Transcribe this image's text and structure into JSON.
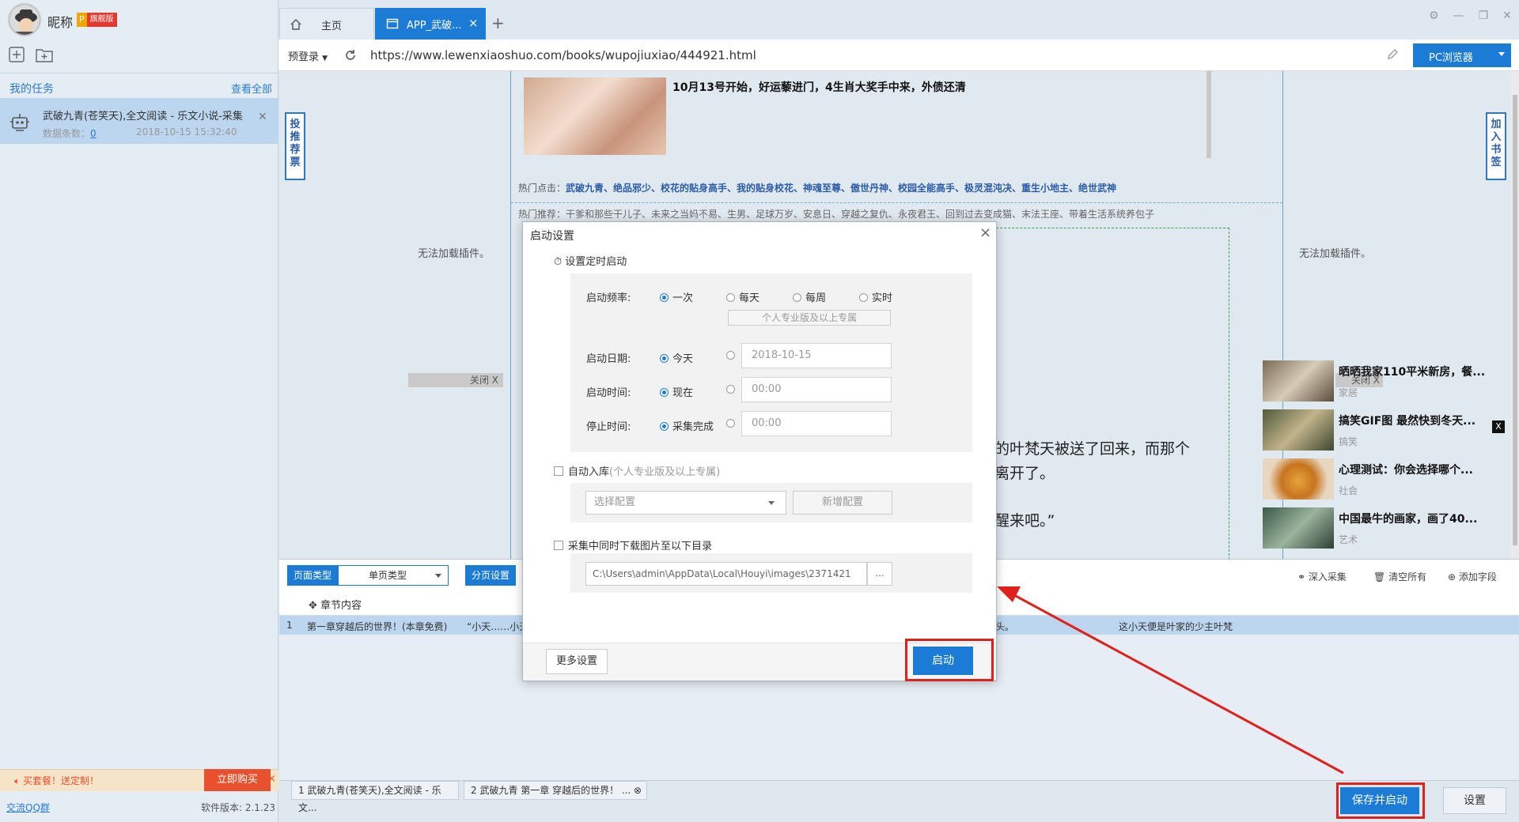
{
  "user": {
    "nickname": "昵称",
    "vip_p": "P",
    "vip_label": "旗舰版"
  },
  "tasks": {
    "title": "我的任务",
    "view_all": "查看全部",
    "items": [
      {
        "title": "武破九青(苍笑天),全文阅读 - 乐文小说-采集",
        "count_label": "数据条数：",
        "count": "0",
        "time": "2018-10-15 15:32:40"
      }
    ]
  },
  "promo": {
    "text": "买套餐！送定制！",
    "buy": "立即购买",
    "close": "×"
  },
  "footer": {
    "qq": "交流QQ群",
    "version": "软件版本: 2.1.23"
  },
  "tabs": {
    "home": "主页",
    "app": "APP_武破...",
    "close": "×",
    "plus": "+"
  },
  "addressbar": {
    "prelogin": "预登录",
    "url": "https://www.lewenxiaoshuo.com/books/wupojiuxiao/444921.html",
    "browser": "PC浏览器"
  },
  "web": {
    "headline": "10月13号开始，好运藜进门，4生肖大奖手中来，外债还清",
    "hot_label": "热门点击：",
    "hot_links": "武破九青、绝品邪少、校花的贴身高手、我的贴身校花、神魂至尊、傲世丹神、校园全能高手、极灵混沌决、重生小地主、绝世武神",
    "recommend": "热门推荐：干爹和那些干儿子、未来之当妈不易、生男、足球万岁、安息日、穿越之复仇、永夜君王、回到过去变成猫、末法王座、带着生活系统养包子",
    "vote": "投推荐票",
    "bookmark": "加入书签",
    "no_plugin": "无法加载插件。",
    "close_ad": "关闭 X",
    "close_x": "X",
    "story_lines": [
      "的叶梵天被送了回来，而那个",
      "离开了。"
    ],
    "story_line3": "醒来吧。”",
    "news": [
      {
        "title": "晒晒我家110平米新房，餐...",
        "cat": "家居"
      },
      {
        "title": "搞笑GIF图 最然快到冬天...",
        "cat": "搞笑"
      },
      {
        "title": "心理测试：你会选择哪个...",
        "cat": "社会"
      },
      {
        "title": "中国最牛的画家，画了40...",
        "cat": "艺术"
      }
    ]
  },
  "toolbar": {
    "page_type_label": "页面类型",
    "page_type_value": "单页类型",
    "page_setting": "分页设置",
    "deep_collect": "深入采集",
    "clear_all": "清空所有",
    "add_field": "添加字段"
  },
  "table": {
    "column": "章节内容",
    "rows": [
      {
        "num": "1",
        "c1": "第一章穿越后的世界！(本章免费)",
        "c2": "“小天……小天",
        "c3": "后不由轻轻的摇了摇头。",
        "c4": "这小天便是叶家的少主叶梵"
      }
    ]
  },
  "status_tabs": [
    "1 武破九青(苍笑天),全文阅读 - 乐文...",
    "2 武破九青 第一章 穿越后的世界！ ..."
  ],
  "buttons": {
    "save_start": "保存并启动",
    "settings": "设置"
  },
  "modal": {
    "title": "启动设置",
    "close": "×",
    "timed_start": "设置定时启动",
    "freq_label": "启动频率:",
    "freq_options": [
      "一次",
      "每天",
      "每周",
      "实时"
    ],
    "pro_note": "个人专业版及以上专属",
    "date_label": "启动日期:",
    "date_option": "今天",
    "date_value": "2018-10-15",
    "time_label": "启动时间:",
    "time_option": "现在",
    "time_value": "00:00",
    "stop_label": "停止时间:",
    "stop_option": "采集完成",
    "stop_value": "00:00",
    "auto_import": "自动入库",
    "auto_import_note": "(个人专业版及以上专属)",
    "select_config": "选择配置",
    "new_config": "新增配置",
    "download_images": "采集中同时下载图片至以下目录",
    "path": "C:\\Users\\admin\\AppData\\Local\\Houyi\\images\\2371421",
    "browse": "...",
    "more_settings": "更多设置",
    "start": "启动"
  },
  "colors": {
    "accent": "#1c7cd5",
    "highlight": "#e0201a",
    "promo": "#e8502e"
  }
}
